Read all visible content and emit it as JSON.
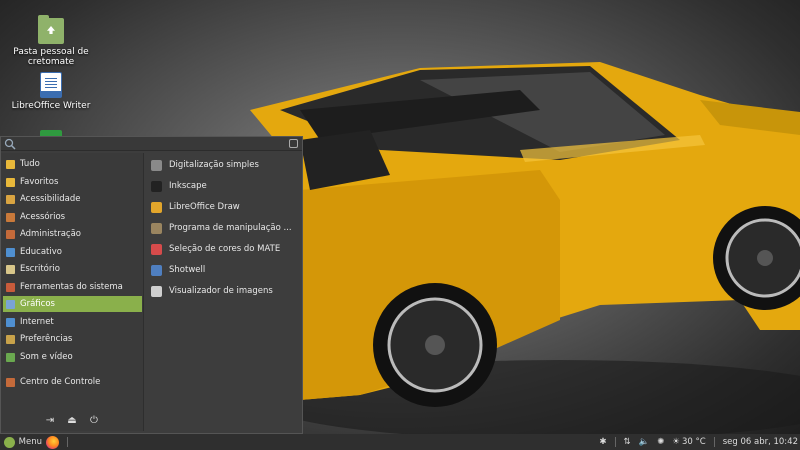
{
  "desktop": {
    "icons": [
      {
        "label_line1": "Pasta pessoal de",
        "label_line2": "cretomate",
        "icon": "home-folder-icon"
      },
      {
        "label_line1": "LibreOffice Writer",
        "label_line2": "",
        "icon": "libreoffice-writer-icon"
      }
    ]
  },
  "menu": {
    "categories": [
      {
        "label": "Tudo",
        "color": "#e8b83a"
      },
      {
        "label": "Favoritos",
        "color": "#e8b83a"
      },
      {
        "label": "Acessibilidade",
        "color": "#d9a441"
      },
      {
        "label": "Acessórios",
        "color": "#c9793a"
      },
      {
        "label": "Administração",
        "color": "#c46a3a"
      },
      {
        "label": "Educativo",
        "color": "#4f8fd0"
      },
      {
        "label": "Escritório",
        "color": "#d8c68a"
      },
      {
        "label": "Ferramentas do sistema",
        "color": "#c85b3b"
      },
      {
        "label": "Gráficos",
        "color": "#7aa3d4"
      },
      {
        "label": "Internet",
        "color": "#4f8fd0"
      },
      {
        "label": "Preferências",
        "color": "#c8a24a"
      },
      {
        "label": "Som e vídeo",
        "color": "#6aa84f"
      },
      {
        "label": "Centro de Controle",
        "color": "#c46a3a"
      }
    ],
    "active_category": "Gráficos",
    "apps": [
      {
        "label": "Digitalização simples",
        "color": "#8a8a8a"
      },
      {
        "label": "Inkscape",
        "color": "#222222"
      },
      {
        "label": "LibreOffice Draw",
        "color": "#e3a62b"
      },
      {
        "label": "Programa de manipulação ...",
        "color": "#9a8560"
      },
      {
        "label": "Seleção de cores do MATE",
        "color": "#d64b4b"
      },
      {
        "label": "Shotwell",
        "color": "#4f7fc0"
      },
      {
        "label": "Visualizador de imagens",
        "color": "#cfcfcf"
      }
    ]
  },
  "panel": {
    "menu_label": "Menu",
    "temperature": "30 °C",
    "datetime": "seg 06 abr, 10:42"
  }
}
